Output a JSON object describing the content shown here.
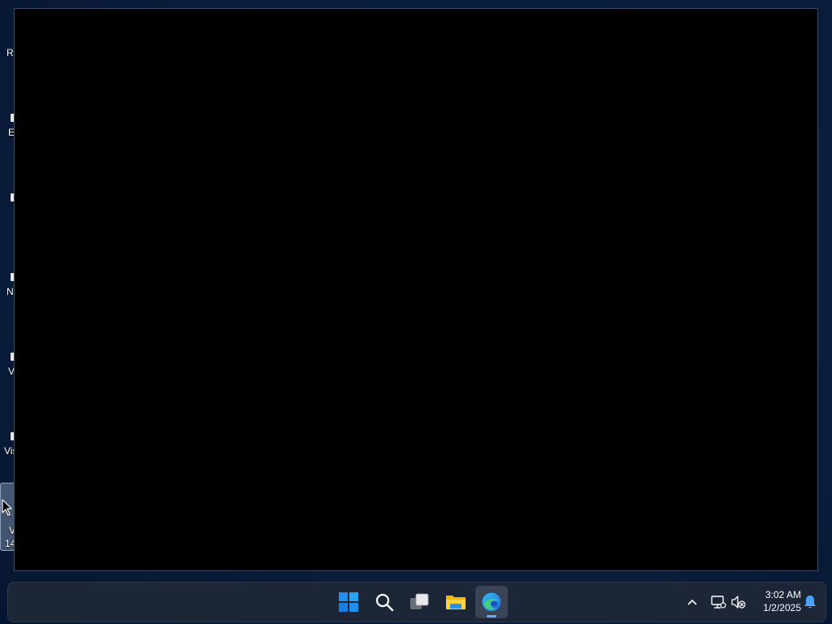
{
  "desktop": {
    "icons": [
      {
        "label": "R"
      },
      {
        "label": "E"
      },
      {
        "label": ""
      },
      {
        "label": "N"
      },
      {
        "label": "V"
      },
      {
        "label": "Vis"
      },
      {
        "label_line1": "V",
        "label_line2": "14"
      }
    ]
  },
  "taskbar": {
    "buttons": [
      {
        "icon": "windows-start-icon"
      },
      {
        "icon": "search-icon"
      },
      {
        "icon": "task-view-icon"
      },
      {
        "icon": "file-explorer-icon"
      },
      {
        "icon": "edge-browser-icon",
        "active": true
      }
    ],
    "tray": {
      "icons": [
        "chevron-up-icon",
        "network-icon",
        "volume-muted-icon",
        "notification-bell-icon"
      ],
      "time": "3:02 AM",
      "date": "1/2/2025"
    },
    "accent": "#6aa8ff"
  },
  "window": {
    "background": "#000000"
  }
}
